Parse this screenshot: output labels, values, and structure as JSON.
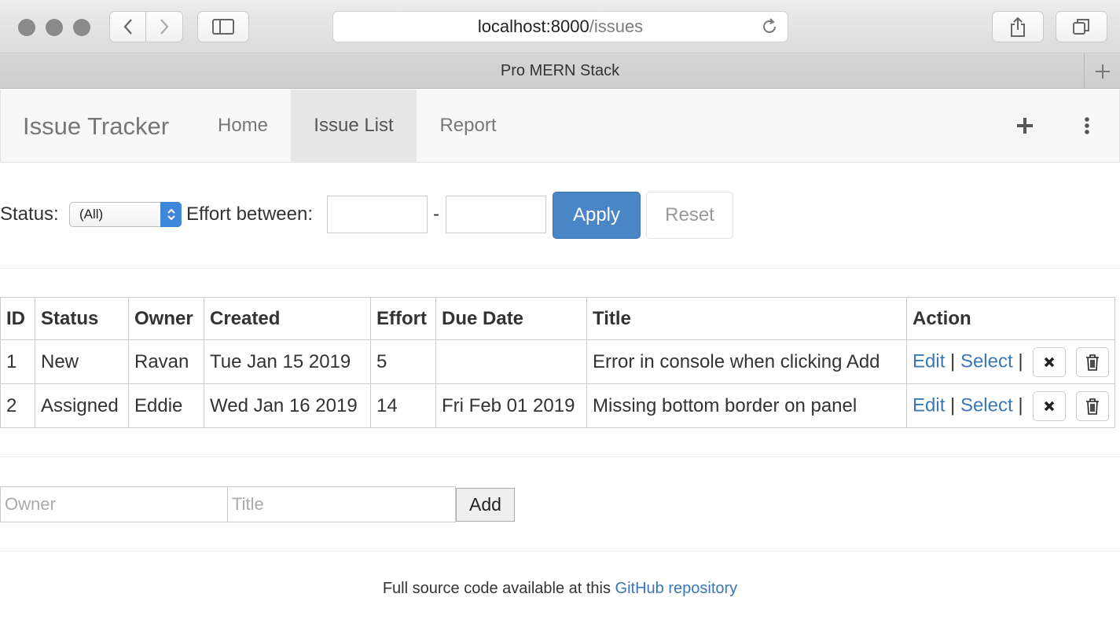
{
  "browser": {
    "url_host": "localhost:8000",
    "url_path": "/issues",
    "tab_title": "Pro MERN Stack"
  },
  "navbar": {
    "brand": "Issue Tracker",
    "items": [
      {
        "label": "Home",
        "active": false
      },
      {
        "label": "Issue List",
        "active": true
      },
      {
        "label": "Report",
        "active": false
      }
    ]
  },
  "filter": {
    "status_label": "Status:",
    "status_value": "(All)",
    "effort_label": "Effort between:",
    "effort_separator": "-",
    "effort_min": "",
    "effort_max": "",
    "apply_label": "Apply",
    "reset_label": "Reset"
  },
  "table": {
    "headers": [
      "ID",
      "Status",
      "Owner",
      "Created",
      "Effort",
      "Due Date",
      "Title",
      "Action"
    ],
    "rows": [
      {
        "id": "1",
        "status": "New",
        "owner": "Ravan",
        "created": "Tue Jan 15 2019",
        "effort": "5",
        "due": "",
        "title": "Error in console when clicking Add"
      },
      {
        "id": "2",
        "status": "Assigned",
        "owner": "Eddie",
        "created": "Wed Jan 16 2019",
        "effort": "14",
        "due": "Fri Feb 01 2019",
        "title": "Missing bottom border on panel"
      }
    ],
    "action_edit": "Edit",
    "action_select": "Select",
    "action_sep": "|"
  },
  "add_form": {
    "owner_placeholder": "Owner",
    "title_placeholder": "Title",
    "add_label": "Add"
  },
  "footer": {
    "text": "Full source code available at this ",
    "link": "GitHub repository"
  },
  "colors": {
    "primary": "#4a86c6",
    "link": "#3a77b6",
    "navbar_bg": "#f8f8f8"
  }
}
